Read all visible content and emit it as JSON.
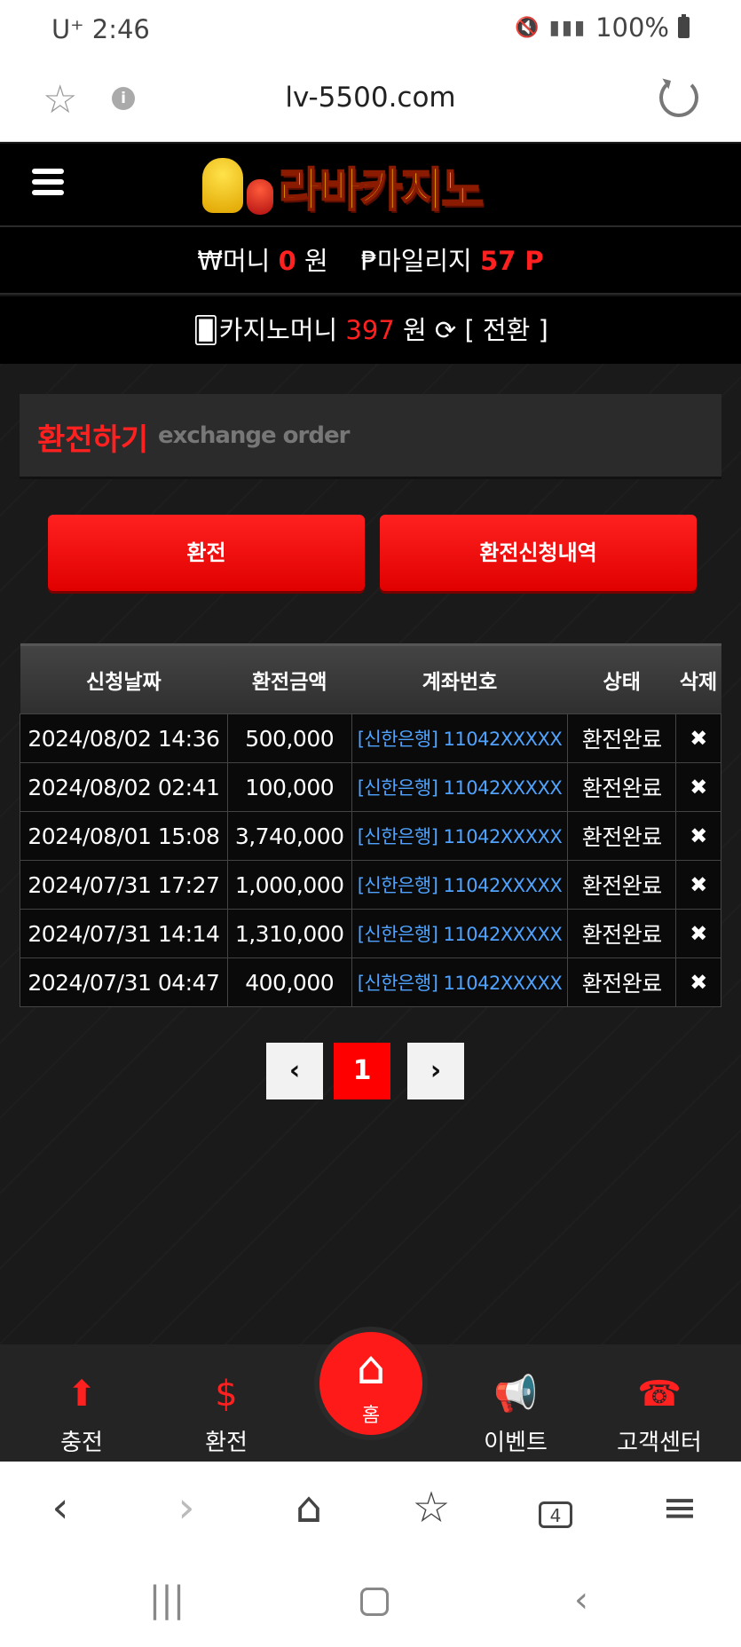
{
  "status_bar": {
    "carrier": "U⁺ 2:46",
    "battery": "100%"
  },
  "browser": {
    "url": "lv-5500.com"
  },
  "header": {
    "logo_text": "라바카지노",
    "money_label": "₩머니",
    "money_value": "0",
    "money_unit": "원",
    "mileage_label": "₱마일리지",
    "mileage_value": "57 P",
    "casino_label": "🂠카지노머니",
    "casino_value": "397",
    "casino_unit": "원",
    "convert_label": "[ 전환 ]"
  },
  "section": {
    "title_ko": "환전하기",
    "title_en": "exchange order"
  },
  "buttons": {
    "exchange": "환전",
    "history": "환전신청내역"
  },
  "table": {
    "headers": [
      "신청날짜",
      "환전금액",
      "계좌번호",
      "상태",
      "삭제"
    ],
    "rows": [
      {
        "date": "2024/08/02 14:36",
        "amount": "500,000",
        "account": "[신한은행] 11042XXXXX",
        "status": "환전완료",
        "delete": "✖"
      },
      {
        "date": "2024/08/02 02:41",
        "amount": "100,000",
        "account": "[신한은행] 11042XXXXX",
        "status": "환전완료",
        "delete": "✖"
      },
      {
        "date": "2024/08/01 15:08",
        "amount": "3,740,000",
        "account": "[신한은행] 11042XXXXX",
        "status": "환전완료",
        "delete": "✖"
      },
      {
        "date": "2024/07/31 17:27",
        "amount": "1,000,000",
        "account": "[신한은행] 11042XXXXX",
        "status": "환전완료",
        "delete": "✖"
      },
      {
        "date": "2024/07/31 14:14",
        "amount": "1,310,000",
        "account": "[신한은행] 11042XXXXX",
        "status": "환전완료",
        "delete": "✖"
      },
      {
        "date": "2024/07/31 04:47",
        "amount": "400,000",
        "account": "[신한은행] 11042XXXXX",
        "status": "환전완료",
        "delete": "✖"
      }
    ]
  },
  "pagination": {
    "prev": "‹",
    "current": "1",
    "next": "›"
  },
  "bottom_nav": {
    "deposit": "충전",
    "exchange": "환전",
    "home": "홈",
    "event": "이벤트",
    "support": "고객센터"
  },
  "browser_toolbar": {
    "tabs_count": "4"
  },
  "colors": {
    "accent": "#ff2020",
    "link": "#4fa3ff"
  }
}
